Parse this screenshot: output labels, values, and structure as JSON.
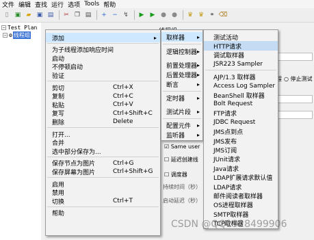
{
  "menubar": [
    "文件",
    "编辑",
    "查找",
    "运行",
    "选项",
    "Tools",
    "帮助"
  ],
  "toolbar": {
    "icons": [
      "new-icon",
      "template-icon",
      "open-icon",
      "save-icon",
      "save-as-icon",
      "cut-icon",
      "copy-icon",
      "paste-icon",
      "expand-icon",
      "collapse-icon",
      "toggle-icon",
      "start-icon",
      "start-no-pause-icon",
      "stop-icon",
      "shutdown-icon",
      "clear-icon",
      "clear-all-icon",
      "search-icon",
      "reset-search-icon"
    ],
    "glyphs": [
      "▯",
      "▣",
      "▰",
      "▣",
      "▤",
      "✂",
      "❐",
      "▤",
      "+",
      "−",
      "↯",
      "▶",
      "▶",
      "●",
      "●",
      "♛",
      "♛",
      "⚭",
      "⌫"
    ]
  },
  "tree": {
    "root": "Test Plan",
    "child": "线程组"
  },
  "right_panel": {
    "title": "线程组",
    "radio_partial": "程",
    "stop_label": "停止测试",
    "same_user": "Same user",
    "delay_create": "延迟创建线",
    "scheduler": "调度器",
    "duration": "持续时间（秒）",
    "startup_delay": "启动延迟（秒）"
  },
  "context_menu": [
    {
      "label": "添加",
      "arrow": true
    },
    {
      "sep": true
    },
    {
      "label": "为子线程添加响应时间"
    },
    {
      "label": "启动"
    },
    {
      "label": "不停顿启动"
    },
    {
      "label": "验证"
    },
    {
      "sep": true
    },
    {
      "label": "剪切",
      "shortcut": "Ctrl+X"
    },
    {
      "label": "复制",
      "shortcut": "Ctrl+C"
    },
    {
      "label": "粘贴",
      "shortcut": "Ctrl+V"
    },
    {
      "label": "复写",
      "shortcut": "Ctrl+Shift+C"
    },
    {
      "label": "删除",
      "shortcut": "Delete"
    },
    {
      "sep": true
    },
    {
      "label": "打开..."
    },
    {
      "label": "合并"
    },
    {
      "label": "选中部分保存为..."
    },
    {
      "sep": true
    },
    {
      "label": "保存节点为图片",
      "shortcut": "Ctrl+G"
    },
    {
      "label": "保存屏幕为图片",
      "shortcut": "Ctrl+Shift+G"
    },
    {
      "sep": true
    },
    {
      "label": "启用"
    },
    {
      "label": "禁用"
    },
    {
      "label": "切换",
      "shortcut": "Ctrl+T"
    },
    {
      "sep": true
    },
    {
      "label": "帮助"
    }
  ],
  "add_submenu": [
    {
      "label": "取样器"
    },
    {
      "label": "逻辑控制器"
    },
    {
      "label": "前置处理器"
    },
    {
      "label": "后置处理器"
    },
    {
      "label": "断言"
    },
    {
      "label": "定时器"
    },
    {
      "label": "测试片段"
    },
    {
      "label": "配置元件"
    },
    {
      "label": "监听器"
    }
  ],
  "sampler_submenu": [
    "测试活动",
    "HTTP请求",
    "调试取样器",
    "JSR223 Sampler",
    "AJP/1.3 取样器",
    "Access Log Sampler",
    "BeanShell 取样器",
    "Bolt Request",
    "FTP请求",
    "JDBC Request",
    "JMS点到点",
    "JMS发布",
    "JMS订阅",
    "JUnit请求",
    "Java请求",
    "LDAP扩展请求默认值",
    "LDAP请求",
    "邮件阅读者取样器",
    "OS进程取样器",
    "SMTP取样器",
    "TCP取样器"
  ],
  "watermark": "CSDN @QQ1928499906"
}
